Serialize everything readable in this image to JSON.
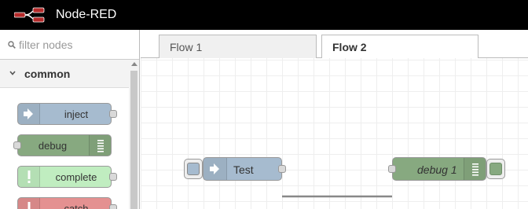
{
  "header": {
    "title": "Node-RED"
  },
  "palette": {
    "filter_placeholder": "filter nodes",
    "category": "common",
    "nodes": [
      {
        "label": "inject",
        "color": "#a6bbcf",
        "icon": "arrow-in-icon"
      },
      {
        "label": "debug",
        "color": "#87a980",
        "icon": "list-icon"
      },
      {
        "label": "complete",
        "color": "#c0edc0",
        "icon": "exclamation-icon"
      },
      {
        "label": "catch",
        "color": "#e49191",
        "icon": "exclamation-icon"
      }
    ]
  },
  "tabs": [
    {
      "label": "Flow 1",
      "active": false
    },
    {
      "label": "Flow 2",
      "active": true
    }
  ],
  "flow": {
    "nodes": [
      {
        "label": "Test",
        "type": "inject",
        "color": "#a6bbcf"
      },
      {
        "label": "debug 1",
        "type": "debug",
        "color": "#87a980"
      }
    ]
  }
}
